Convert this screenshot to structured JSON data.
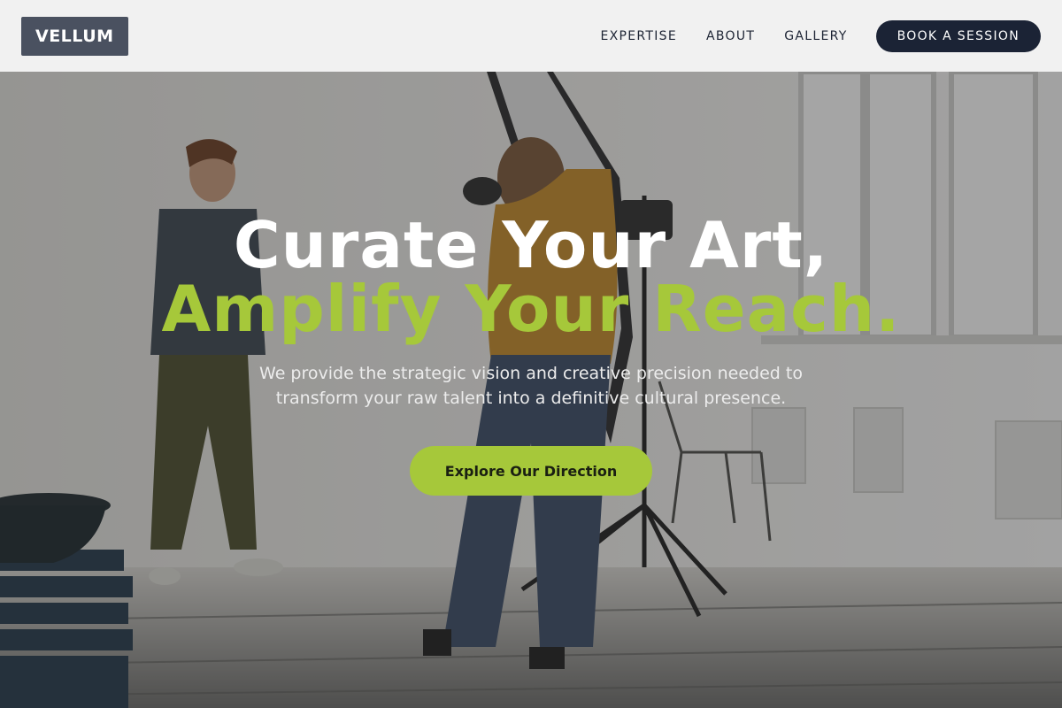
{
  "header": {
    "logo": "VELLUM",
    "nav": [
      "EXPERTISE",
      "ABOUT",
      "GALLERY"
    ],
    "cta": "BOOK A SESSION"
  },
  "hero": {
    "headline_line1": "Curate Your Art,",
    "headline_line2": "Amplify Your Reach.",
    "subtext": "We provide the strategic vision and creative precision needed to transform your raw talent into a definitive cultural presence.",
    "cta": "Explore Our Direction"
  },
  "colors": {
    "accent": "#a6c83a",
    "header_bg": "#f1f1f1",
    "logo_bg": "#4a5160",
    "nav_text": "#1d2434",
    "button_dark": "#1b2335"
  }
}
